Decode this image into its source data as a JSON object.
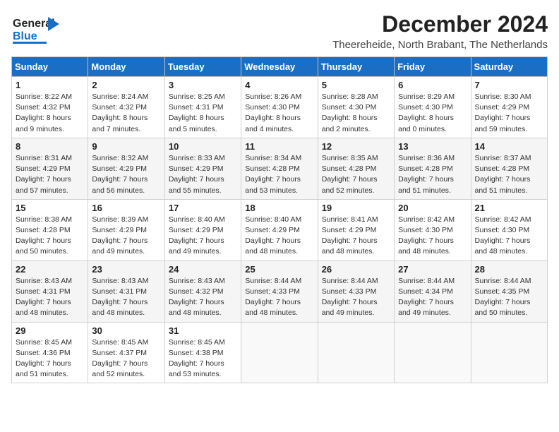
{
  "logo": {
    "line1": "General",
    "line2": "Blue"
  },
  "title": "December 2024",
  "subtitle": "Theereheide, North Brabant, The Netherlands",
  "days_of_week": [
    "Sunday",
    "Monday",
    "Tuesday",
    "Wednesday",
    "Thursday",
    "Friday",
    "Saturday"
  ],
  "weeks": [
    [
      {
        "day": "1",
        "sunrise": "8:22 AM",
        "sunset": "4:32 PM",
        "daylight": "8 hours and 9 minutes."
      },
      {
        "day": "2",
        "sunrise": "8:24 AM",
        "sunset": "4:32 PM",
        "daylight": "8 hours and 7 minutes."
      },
      {
        "day": "3",
        "sunrise": "8:25 AM",
        "sunset": "4:31 PM",
        "daylight": "8 hours and 5 minutes."
      },
      {
        "day": "4",
        "sunrise": "8:26 AM",
        "sunset": "4:30 PM",
        "daylight": "8 hours and 4 minutes."
      },
      {
        "day": "5",
        "sunrise": "8:28 AM",
        "sunset": "4:30 PM",
        "daylight": "8 hours and 2 minutes."
      },
      {
        "day": "6",
        "sunrise": "8:29 AM",
        "sunset": "4:30 PM",
        "daylight": "8 hours and 0 minutes."
      },
      {
        "day": "7",
        "sunrise": "8:30 AM",
        "sunset": "4:29 PM",
        "daylight": "7 hours and 59 minutes."
      }
    ],
    [
      {
        "day": "8",
        "sunrise": "8:31 AM",
        "sunset": "4:29 PM",
        "daylight": "7 hours and 57 minutes."
      },
      {
        "day": "9",
        "sunrise": "8:32 AM",
        "sunset": "4:29 PM",
        "daylight": "7 hours and 56 minutes."
      },
      {
        "day": "10",
        "sunrise": "8:33 AM",
        "sunset": "4:29 PM",
        "daylight": "7 hours and 55 minutes."
      },
      {
        "day": "11",
        "sunrise": "8:34 AM",
        "sunset": "4:28 PM",
        "daylight": "7 hours and 53 minutes."
      },
      {
        "day": "12",
        "sunrise": "8:35 AM",
        "sunset": "4:28 PM",
        "daylight": "7 hours and 52 minutes."
      },
      {
        "day": "13",
        "sunrise": "8:36 AM",
        "sunset": "4:28 PM",
        "daylight": "7 hours and 51 minutes."
      },
      {
        "day": "14",
        "sunrise": "8:37 AM",
        "sunset": "4:28 PM",
        "daylight": "7 hours and 51 minutes."
      }
    ],
    [
      {
        "day": "15",
        "sunrise": "8:38 AM",
        "sunset": "4:28 PM",
        "daylight": "7 hours and 50 minutes."
      },
      {
        "day": "16",
        "sunrise": "8:39 AM",
        "sunset": "4:29 PM",
        "daylight": "7 hours and 49 minutes."
      },
      {
        "day": "17",
        "sunrise": "8:40 AM",
        "sunset": "4:29 PM",
        "daylight": "7 hours and 49 minutes."
      },
      {
        "day": "18",
        "sunrise": "8:40 AM",
        "sunset": "4:29 PM",
        "daylight": "7 hours and 48 minutes."
      },
      {
        "day": "19",
        "sunrise": "8:41 AM",
        "sunset": "4:29 PM",
        "daylight": "7 hours and 48 minutes."
      },
      {
        "day": "20",
        "sunrise": "8:42 AM",
        "sunset": "4:30 PM",
        "daylight": "7 hours and 48 minutes."
      },
      {
        "day": "21",
        "sunrise": "8:42 AM",
        "sunset": "4:30 PM",
        "daylight": "7 hours and 48 minutes."
      }
    ],
    [
      {
        "day": "22",
        "sunrise": "8:43 AM",
        "sunset": "4:31 PM",
        "daylight": "7 hours and 48 minutes."
      },
      {
        "day": "23",
        "sunrise": "8:43 AM",
        "sunset": "4:31 PM",
        "daylight": "7 hours and 48 minutes."
      },
      {
        "day": "24",
        "sunrise": "8:43 AM",
        "sunset": "4:32 PM",
        "daylight": "7 hours and 48 minutes."
      },
      {
        "day": "25",
        "sunrise": "8:44 AM",
        "sunset": "4:33 PM",
        "daylight": "7 hours and 48 minutes."
      },
      {
        "day": "26",
        "sunrise": "8:44 AM",
        "sunset": "4:33 PM",
        "daylight": "7 hours and 49 minutes."
      },
      {
        "day": "27",
        "sunrise": "8:44 AM",
        "sunset": "4:34 PM",
        "daylight": "7 hours and 49 minutes."
      },
      {
        "day": "28",
        "sunrise": "8:44 AM",
        "sunset": "4:35 PM",
        "daylight": "7 hours and 50 minutes."
      }
    ],
    [
      {
        "day": "29",
        "sunrise": "8:45 AM",
        "sunset": "4:36 PM",
        "daylight": "7 hours and 51 minutes."
      },
      {
        "day": "30",
        "sunrise": "8:45 AM",
        "sunset": "4:37 PM",
        "daylight": "7 hours and 52 minutes."
      },
      {
        "day": "31",
        "sunrise": "8:45 AM",
        "sunset": "4:38 PM",
        "daylight": "7 hours and 53 minutes."
      },
      null,
      null,
      null,
      null
    ]
  ],
  "labels": {
    "sunrise": "Sunrise:",
    "sunset": "Sunset:",
    "daylight": "Daylight:"
  }
}
